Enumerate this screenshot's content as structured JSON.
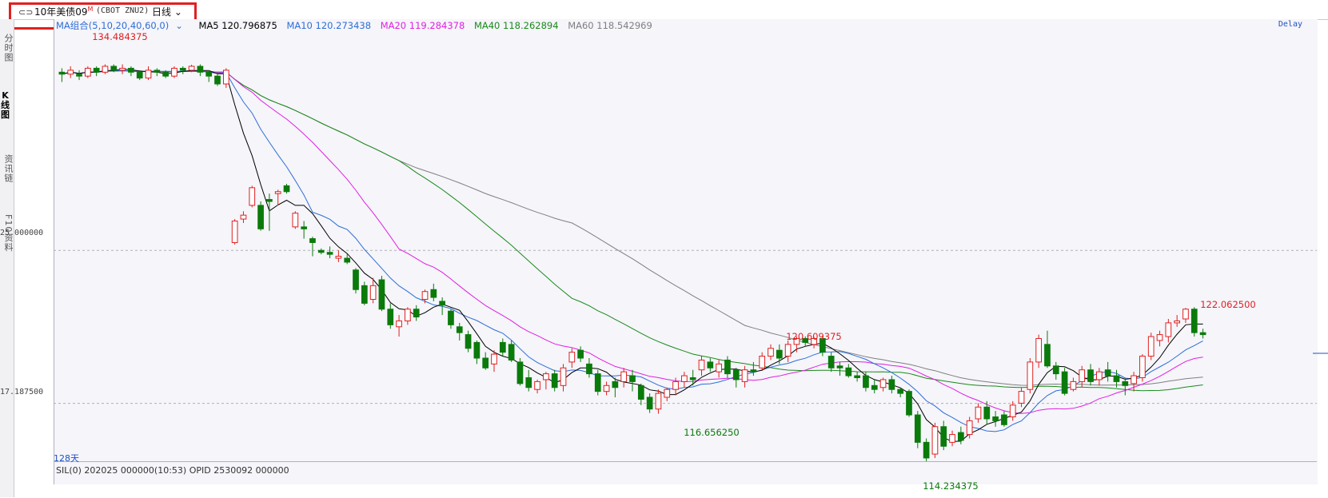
{
  "header": {
    "link_icon": "link-icon",
    "instrument": "10年美债09",
    "superscript": "M",
    "contract": "(CBOT ZNU2)",
    "period": "日线"
  },
  "sidebar": {
    "tabs": [
      "分时图",
      "K线图",
      "资讯链",
      "F10资料"
    ]
  },
  "legend": {
    "ma_combo": "MA组合(5,10,20,40,60,0)",
    "ma5": "MA5 120.796875",
    "ma10": "MA10 120.273438",
    "ma20": "MA20 119.284378",
    "ma40": "MA40 118.262894",
    "ma60": "MA60 118.542969",
    "colors": {
      "ma5": "#000000",
      "ma10": "#2e6ed6",
      "ma20": "#e020e0",
      "ma40": "#1a8a1a",
      "ma60": "#808080"
    }
  },
  "status": {
    "delay": "Delay",
    "days": "128天",
    "bottom_line": "SIL(0)   202025 000000(10:53)  OPID 2530092 000000"
  },
  "y_axis": {
    "ticks": [
      "25.000000",
      "17.187500"
    ]
  },
  "annotations": {
    "high": "134.484375",
    "peak1": "120.609375",
    "recent_high": "122.062500",
    "low1": "116.656250",
    "low2": "114.234375"
  },
  "chart_data": {
    "type": "candlestick",
    "up_color": "#e02020",
    "down_color": "#0a7a0a",
    "ylim": [
      113.5,
      135.5
    ],
    "gridlines": [
      125.0,
      117.1875
    ],
    "candles": [
      [
        134.1,
        134.0,
        134.3,
        133.6
      ],
      [
        134.0,
        134.2,
        134.4,
        133.8
      ],
      [
        134.0,
        133.9,
        134.2,
        133.7
      ],
      [
        133.9,
        134.3,
        134.4,
        133.8
      ],
      [
        134.3,
        134.1,
        134.4,
        133.9
      ],
      [
        134.1,
        134.4,
        134.5,
        134.0
      ],
      [
        134.4,
        134.2,
        134.5,
        134.1
      ],
      [
        134.2,
        134.3,
        134.5,
        134.0
      ],
      [
        134.3,
        134.1,
        134.4,
        133.9
      ],
      [
        134.1,
        133.8,
        134.2,
        133.7
      ],
      [
        133.8,
        134.2,
        134.4,
        133.7
      ],
      [
        134.2,
        134.1,
        134.3,
        133.9
      ],
      [
        134.1,
        133.9,
        134.2,
        133.8
      ],
      [
        133.9,
        134.3,
        134.4,
        133.8
      ],
      [
        134.3,
        134.2,
        134.4,
        134.0
      ],
      [
        134.2,
        134.4,
        134.48,
        134.1
      ],
      [
        134.4,
        134.1,
        134.5,
        133.9
      ],
      [
        134.1,
        133.9,
        134.2,
        133.6
      ],
      [
        133.9,
        133.5,
        134.1,
        133.4
      ],
      [
        133.5,
        134.2,
        134.3,
        133.3
      ],
      [
        125.4,
        126.5,
        126.6,
        125.3
      ],
      [
        126.6,
        126.8,
        127.0,
        126.4
      ],
      [
        127.3,
        128.2,
        128.3,
        127.2
      ],
      [
        127.3,
        126.1,
        127.5,
        126.0
      ],
      [
        127.6,
        127.5,
        127.9,
        126.0
      ],
      [
        127.9,
        128.0,
        128.1,
        127.3
      ],
      [
        128.3,
        128.0,
        128.4,
        127.9
      ],
      [
        126.2,
        126.9,
        127.0,
        126.1
      ],
      [
        126.2,
        126.1,
        126.5,
        125.6
      ],
      [
        125.6,
        125.4,
        125.7,
        124.7
      ],
      [
        125.0,
        124.9,
        125.1,
        124.8
      ],
      [
        124.9,
        124.8,
        125.2,
        124.6
      ],
      [
        124.6,
        124.7,
        125.0,
        124.4
      ],
      [
        124.6,
        124.4,
        124.8,
        124.3
      ],
      [
        124.0,
        123.0,
        124.1,
        122.8
      ],
      [
        123.2,
        122.3,
        123.4,
        122.2
      ],
      [
        122.5,
        123.2,
        123.6,
        122.3
      ],
      [
        123.5,
        122.0,
        123.7,
        121.9
      ],
      [
        122.0,
        121.2,
        122.3,
        121.0
      ],
      [
        121.1,
        121.4,
        121.7,
        120.6
      ],
      [
        121.4,
        122.0,
        122.1,
        121.2
      ],
      [
        122.0,
        121.6,
        122.2,
        121.4
      ],
      [
        122.5,
        122.9,
        123.0,
        122.3
      ],
      [
        123.0,
        122.6,
        123.3,
        122.4
      ],
      [
        122.4,
        122.2,
        122.6,
        121.7
      ],
      [
        121.9,
        121.2,
        122.0,
        121.0
      ],
      [
        121.1,
        120.8,
        121.3,
        120.4
      ],
      [
        120.7,
        120.0,
        120.9,
        119.8
      ],
      [
        120.3,
        119.5,
        120.4,
        119.2
      ],
      [
        119.5,
        119.0,
        119.8,
        118.9
      ],
      [
        119.2,
        119.7,
        119.9,
        118.8
      ],
      [
        120.3,
        119.8,
        120.5,
        119.6
      ],
      [
        120.2,
        119.4,
        120.4,
        119.3
      ],
      [
        119.3,
        118.2,
        119.5,
        118.1
      ],
      [
        118.5,
        118.0,
        118.9,
        117.8
      ],
      [
        117.9,
        118.3,
        118.4,
        117.7
      ],
      [
        118.4,
        118.7,
        118.8,
        117.9
      ],
      [
        118.7,
        118.0,
        118.9,
        117.8
      ],
      [
        118.1,
        119.0,
        119.2,
        117.8
      ],
      [
        119.3,
        119.8,
        120.0,
        119.0
      ],
      [
        119.9,
        119.5,
        120.1,
        119.3
      ],
      [
        119.2,
        118.7,
        119.5,
        118.5
      ],
      [
        118.7,
        117.8,
        118.9,
        117.6
      ],
      [
        117.8,
        118.1,
        118.3,
        117.6
      ],
      [
        118.3,
        118.0,
        118.5,
        117.5
      ],
      [
        118.3,
        118.8,
        119.0,
        118.0
      ],
      [
        118.6,
        118.3,
        118.9,
        117.8
      ],
      [
        118.1,
        117.4,
        118.2,
        117.1
      ],
      [
        117.5,
        116.9,
        117.7,
        116.7
      ],
      [
        116.9,
        117.7,
        117.9,
        116.66
      ],
      [
        117.5,
        117.9,
        118.0,
        117.3
      ],
      [
        117.9,
        118.3,
        118.5,
        117.6
      ],
      [
        118.3,
        118.6,
        118.8,
        118.0
      ],
      [
        118.5,
        118.4,
        118.9,
        118.1
      ],
      [
        118.9,
        119.4,
        119.6,
        118.6
      ],
      [
        119.3,
        119.0,
        119.5,
        118.8
      ],
      [
        118.8,
        119.2,
        119.4,
        118.5
      ],
      [
        119.4,
        118.7,
        119.6,
        118.5
      ],
      [
        118.9,
        118.4,
        119.0,
        118.0
      ],
      [
        118.3,
        118.9,
        119.1,
        118.0
      ],
      [
        118.9,
        118.8,
        119.3,
        118.6
      ],
      [
        119.0,
        119.6,
        119.8,
        118.9
      ],
      [
        119.6,
        120.0,
        120.2,
        119.4
      ],
      [
        119.9,
        119.5,
        120.2,
        119.2
      ],
      [
        119.6,
        120.2,
        120.4,
        119.3
      ],
      [
        120.2,
        120.5,
        120.6,
        119.8
      ],
      [
        120.5,
        120.3,
        120.61,
        120.1
      ],
      [
        120.2,
        120.5,
        120.6,
        120.0
      ],
      [
        120.5,
        119.8,
        120.6,
        119.6
      ],
      [
        119.6,
        119.0,
        119.8,
        118.8
      ],
      [
        119.1,
        119.0,
        119.3,
        118.6
      ],
      [
        119.0,
        118.6,
        119.2,
        118.5
      ],
      [
        118.6,
        118.5,
        118.8,
        118.3
      ],
      [
        118.6,
        118.0,
        118.8,
        117.8
      ],
      [
        118.1,
        117.9,
        118.4,
        117.7
      ],
      [
        118.0,
        118.4,
        118.5,
        117.8
      ],
      [
        118.4,
        117.9,
        118.6,
        117.7
      ],
      [
        117.9,
        117.7,
        118.0,
        117.5
      ],
      [
        117.8,
        116.6,
        117.9,
        116.5
      ],
      [
        116.6,
        115.2,
        116.8,
        114.9
      ],
      [
        115.2,
        114.4,
        115.4,
        114.234
      ],
      [
        114.6,
        116.0,
        116.2,
        114.4
      ],
      [
        116.0,
        115.0,
        116.3,
        114.8
      ],
      [
        115.2,
        115.6,
        115.8,
        115.0
      ],
      [
        115.7,
        115.3,
        116.0,
        115.1
      ],
      [
        115.6,
        116.3,
        116.5,
        115.4
      ],
      [
        116.4,
        117.0,
        117.2,
        116.2
      ],
      [
        117.0,
        116.4,
        117.3,
        116.1
      ],
      [
        116.5,
        116.3,
        116.8,
        116.0
      ],
      [
        116.6,
        116.1,
        116.8,
        116.0
      ],
      [
        116.5,
        117.1,
        117.3,
        116.3
      ],
      [
        117.2,
        117.8,
        118.0,
        117.0
      ],
      [
        117.9,
        119.3,
        119.5,
        117.7
      ],
      [
        119.3,
        120.5,
        120.7,
        119.0
      ],
      [
        120.2,
        119.1,
        120.9,
        119.0
      ],
      [
        119.1,
        118.7,
        119.3,
        118.4
      ],
      [
        118.8,
        117.7,
        119.0,
        117.6
      ],
      [
        117.9,
        118.3,
        118.5,
        117.8
      ],
      [
        118.3,
        118.9,
        119.1,
        118.0
      ],
      [
        118.9,
        118.3,
        119.2,
        118.1
      ],
      [
        118.4,
        118.8,
        119.0,
        118.1
      ],
      [
        118.9,
        118.6,
        119.3,
        118.3
      ],
      [
        118.6,
        118.3,
        118.9,
        118.0
      ],
      [
        118.3,
        118.1,
        118.5,
        117.6
      ],
      [
        118.2,
        118.6,
        118.8,
        117.8
      ],
      [
        118.5,
        119.6,
        119.7,
        118.3
      ],
      [
        119.6,
        120.6,
        120.8,
        119.4
      ],
      [
        120.4,
        120.7,
        120.9,
        120.1
      ],
      [
        120.6,
        121.3,
        121.5,
        120.3
      ],
      [
        121.3,
        121.4,
        121.7,
        121.1
      ],
      [
        121.5,
        122.0,
        122.06,
        121.3
      ],
      [
        122.0,
        120.8,
        122.1,
        120.6
      ],
      [
        120.8,
        120.7,
        121.0,
        120.5
      ]
    ]
  }
}
